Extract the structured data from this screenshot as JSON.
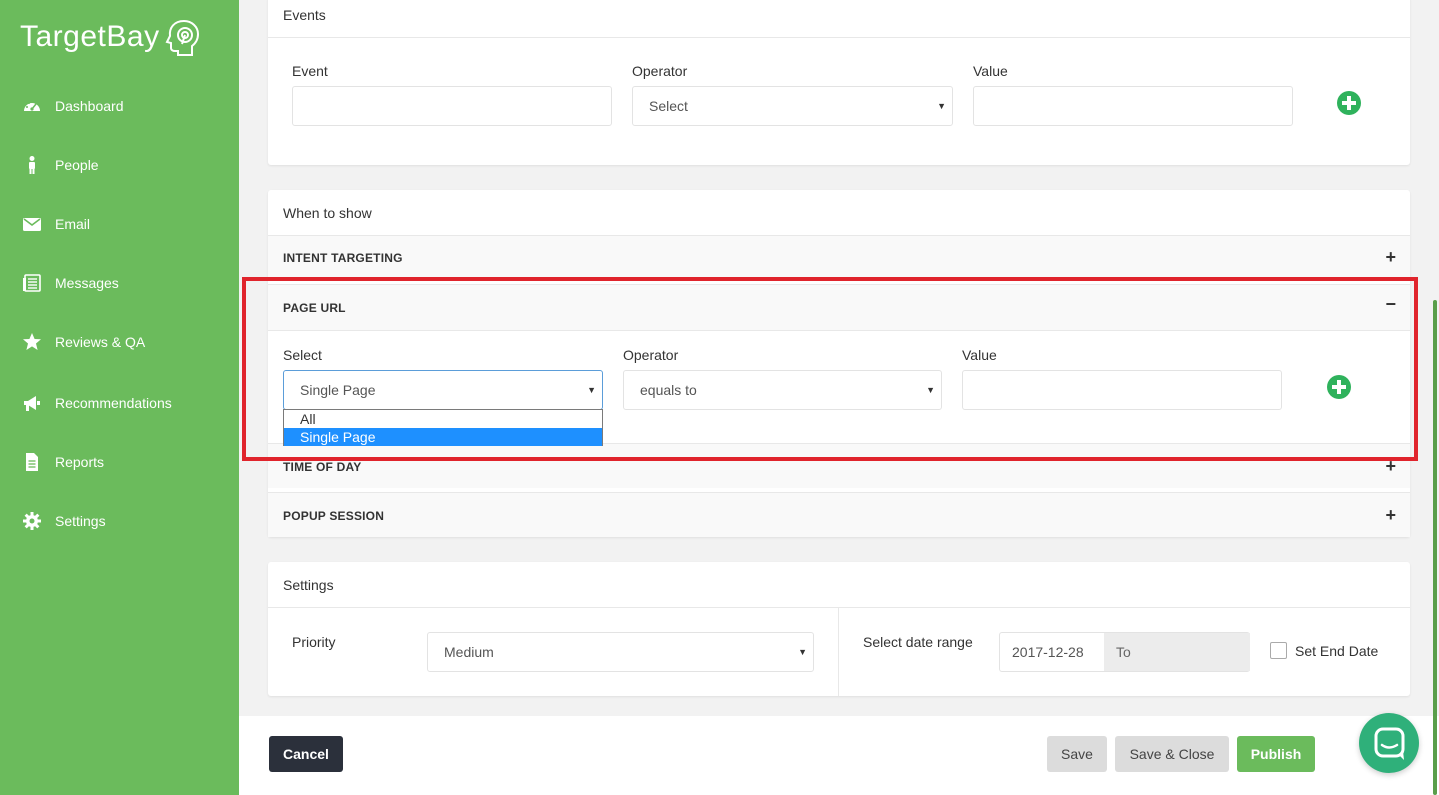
{
  "app": {
    "logo_text": "TargetBay"
  },
  "sidebar": {
    "items": [
      {
        "label": "Dashboard",
        "icon": "dashboard-icon"
      },
      {
        "label": "People",
        "icon": "person-icon"
      },
      {
        "label": "Email",
        "icon": "envelope-icon"
      },
      {
        "label": "Messages",
        "icon": "messages-icon"
      },
      {
        "label": "Reviews & QA",
        "icon": "star-icon"
      },
      {
        "label": "Recommendations",
        "icon": "megaphone-icon"
      },
      {
        "label": "Reports",
        "icon": "document-icon"
      },
      {
        "label": "Settings",
        "icon": "gear-icon"
      }
    ]
  },
  "events": {
    "title": "Events",
    "event_label": "Event",
    "operator_label": "Operator",
    "operator_value": "Select",
    "value_label": "Value"
  },
  "when_to_show": {
    "title": "When to show",
    "sections": {
      "intent": "INTENT TARGETING",
      "page_url": "PAGE URL",
      "time_of_day": "TIME OF DAY",
      "popup_session": "POPUP SESSION"
    },
    "page_url": {
      "select_label": "Select",
      "select_value": "Single Page",
      "operator_label": "Operator",
      "operator_value": "equals to",
      "value_label": "Value",
      "dropdown_options": [
        "All",
        "Single Page"
      ],
      "dropdown_selected": "Single Page"
    }
  },
  "settings": {
    "title": "Settings",
    "priority_label": "Priority",
    "priority_value": "Medium",
    "date_range_label": "Select date range",
    "start_date": "2017-12-28",
    "to_label": "To",
    "set_end_date_label": "Set End Date"
  },
  "footer": {
    "cancel": "Cancel",
    "save": "Save",
    "save_close": "Save & Close",
    "publish": "Publish"
  },
  "colors": {
    "sidebar": "#6bbb5c",
    "accent_green": "#2fb25c",
    "highlight_red": "#e0242c",
    "dropdown_selected": "#1e90ff"
  }
}
